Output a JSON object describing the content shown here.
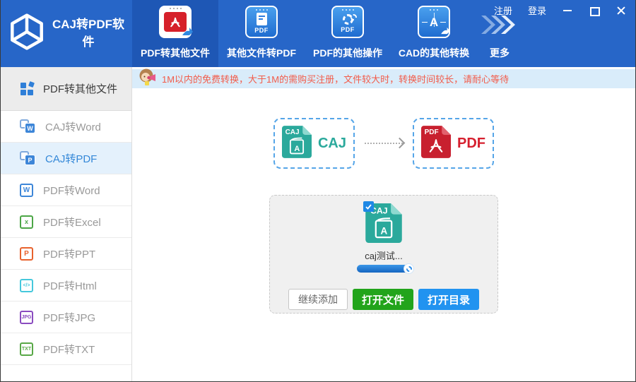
{
  "titlebar": {
    "register": "注册",
    "login": "登录"
  },
  "brand": {
    "title": "CAJ转PDF软件"
  },
  "topnav": {
    "tabs": [
      {
        "label": "PDF转其他文件",
        "icon": "pdf-to-other-icon"
      },
      {
        "label": "其他文件转PDF",
        "icon": "other-to-pdf-icon",
        "badge": "PDF"
      },
      {
        "label": "PDF的其他操作",
        "icon": "pdf-operations-gear-icon",
        "badge": "PDF"
      },
      {
        "label": "CAD的其他转换",
        "icon": "cad-convert-icon",
        "glyph": "A"
      },
      {
        "label": "更多",
        "icon": "more-arrows-icon"
      }
    ]
  },
  "sidebar": {
    "header_label": "PDF转其他文件",
    "items": [
      {
        "label": "CAJ转Word",
        "icon": "caj-to-word-icon",
        "glyph": "W"
      },
      {
        "label": "CAJ转PDF",
        "icon": "caj-to-pdf-icon",
        "glyph": "P"
      },
      {
        "label": "PDF转Word",
        "icon": "pdf-to-word-icon",
        "glyph": "W"
      },
      {
        "label": "PDF转Excel",
        "icon": "pdf-to-excel-icon",
        "glyph": "x"
      },
      {
        "label": "PDF转PPT",
        "icon": "pdf-to-ppt-icon",
        "glyph": "P"
      },
      {
        "label": "PDF转Html",
        "icon": "pdf-to-html-icon",
        "glyph": "</>"
      },
      {
        "label": "PDF转JPG",
        "icon": "pdf-to-jpg-icon",
        "glyph": "JPG"
      },
      {
        "label": "PDF转TXT",
        "icon": "pdf-to-txt-icon",
        "glyph": "TXT"
      }
    ],
    "active_item": "CAJ转PDF"
  },
  "notice": {
    "text": "1M以内的免费转换，大于1M的需购买注册，文件较大时，转换时间较长，请耐心等待"
  },
  "converter": {
    "source": {
      "label": "CAJ",
      "file_type": "CAJ"
    },
    "target": {
      "label": "PDF",
      "file_type": "PDF"
    }
  },
  "dropzone": {
    "file": {
      "name": "caj测试...",
      "type": "CAJ",
      "progress_percent": 100
    },
    "buttons": {
      "add_more": "继续添加",
      "open_file": "打开文件",
      "open_folder": "打开目录"
    }
  },
  "colors": {
    "header_blue": "#2766c8",
    "active_tab_blue": "#1e57b5",
    "banner_bg": "#d9ecfa",
    "banner_text": "#f25c4a",
    "teal": "#2ba99c",
    "pdf_red": "#d6202f",
    "green_button": "#22a41b",
    "blue_button": "#2193f0"
  }
}
